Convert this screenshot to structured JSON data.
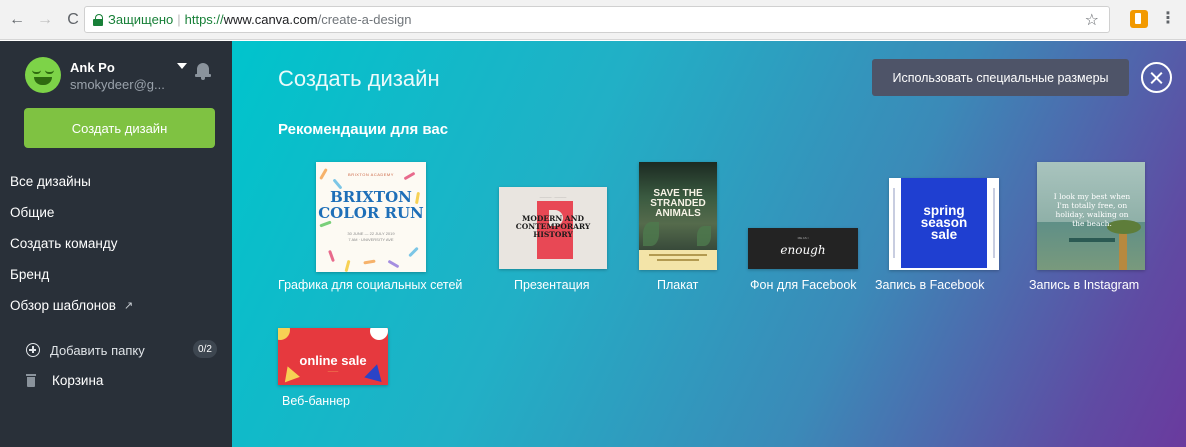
{
  "browser": {
    "secure_label": "Защищено",
    "url_proto": "https://",
    "url_host": "www.canva.com",
    "url_path": "/create-a-design"
  },
  "sidebar": {
    "user_name": "Ank Po",
    "user_email": "smokydeer@g...",
    "create_button": "Создать дизайн",
    "nav_items": [
      {
        "label": "Все дизайны"
      },
      {
        "label": "Общие"
      },
      {
        "label": "Создать команду"
      },
      {
        "label": "Бренд"
      },
      {
        "label": "Обзор шаблонов",
        "arrow": "↗"
      }
    ],
    "add_folder": "Добавить папку",
    "folder_count": "0/2",
    "trash": "Корзина"
  },
  "main": {
    "title": "Создать дизайн",
    "custom_size_button": "Использовать специальные размеры",
    "section_title": "Рекомендации для вас",
    "cards": [
      {
        "label": "Графика для социальных сетей",
        "thumb_text": "BRIXTON\nCOLOR RUN",
        "thumb_header": "BRIXTON ACADEMY",
        "thumb_small": "30 JUNE — 22 JULY 2019\n7 AM · UNIVERSITY AVE"
      },
      {
        "label": "Презентация",
        "thumb_text": "MODERN AND\nCONTEMPORARY\nHISTORY"
      },
      {
        "label": "Плакат",
        "thumb_text": "SAVE THE\nSTRANDED\nANIMALS"
      },
      {
        "label": "Фон для Facebook",
        "thumb_text": "enough",
        "thumb_small": "ME AS I"
      },
      {
        "label": "Запись в Facebook",
        "thumb_text": "spring\nseason\nsale"
      },
      {
        "label": "Запись в Instagram",
        "thumb_text": "I look my best when\nI'm totally free, on\nholiday, walking on\nthe beach."
      },
      {
        "label": "Веб-баннер",
        "thumb_text": "online sale"
      }
    ]
  },
  "colors": {
    "sidebar_bg": "#293039",
    "accent_green": "#7fc242",
    "gradient_start": "#00c4cc",
    "gradient_end": "#6a3a9e"
  }
}
